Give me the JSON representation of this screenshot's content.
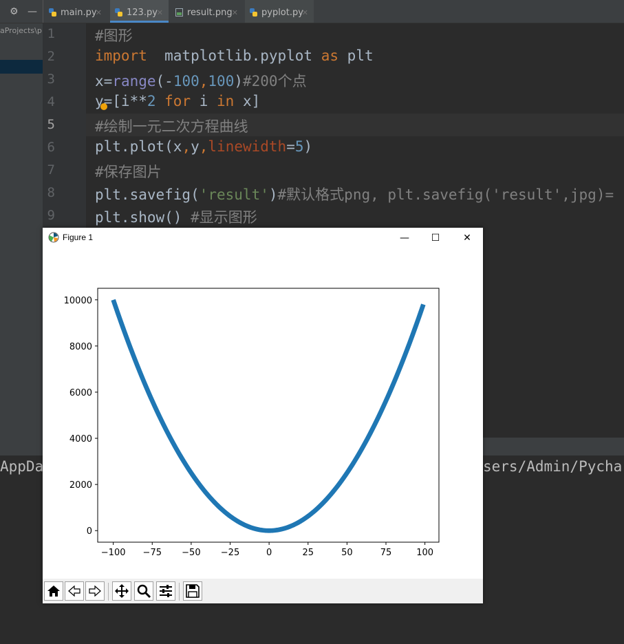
{
  "tabs": [
    {
      "label": "main.py"
    },
    {
      "label": "123.py"
    },
    {
      "label": "result.png"
    },
    {
      "label": "pyplot.py"
    }
  ],
  "project_path": "aProjects\\p",
  "line_numbers": [
    "1",
    "2",
    "3",
    "4",
    "5",
    "6",
    "7",
    "8",
    "9"
  ],
  "run_output": {
    "left": "AppDat",
    "right": "sers/Admin/Pychar"
  },
  "figure": {
    "title": "Figure 1",
    "minimize": "—",
    "maximize": "☐",
    "close": "✕"
  },
  "colors": {
    "accent": "#4a88c7",
    "line": "#1f77b4"
  },
  "icons": {
    "settings": "gear-icon",
    "collapse": "minus-icon"
  },
  "chart_data": {
    "type": "line",
    "title": "",
    "xlabel": "",
    "ylabel": "",
    "xlim": [
      -110,
      109
    ],
    "ylim": [
      -500,
      10500
    ],
    "xticks": [
      "−100",
      "−75",
      "−50",
      "−25",
      "0",
      "25",
      "50",
      "75",
      "100"
    ],
    "yticks": [
      "0",
      "2000",
      "4000",
      "6000",
      "8000",
      "10000"
    ],
    "series": [
      {
        "x_start": -100,
        "x_end": 99,
        "formula": "y = x**2",
        "linewidth": 5
      }
    ]
  }
}
